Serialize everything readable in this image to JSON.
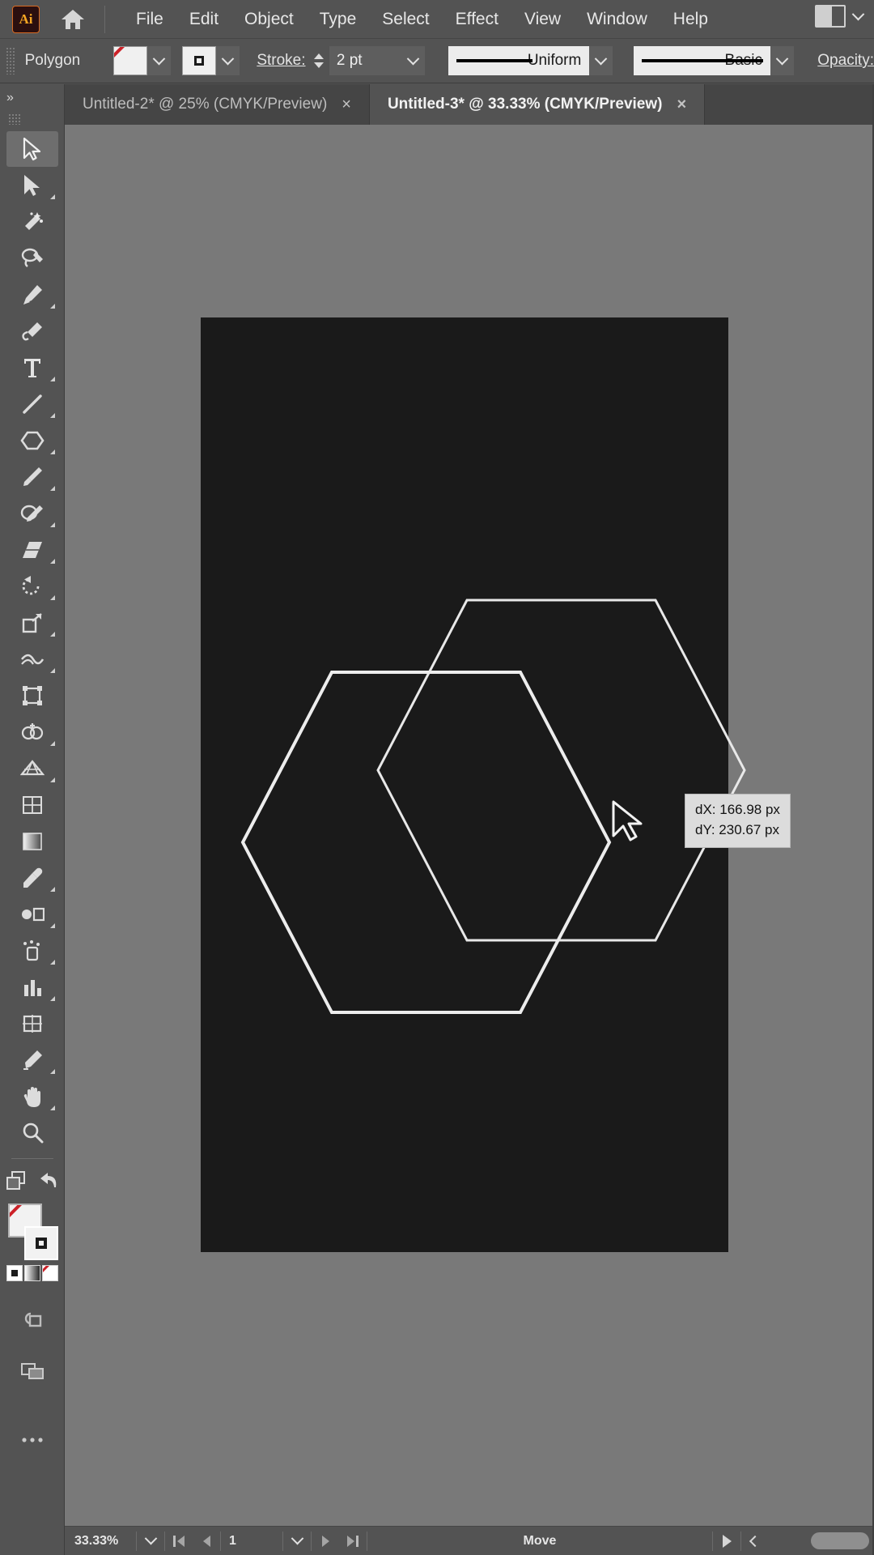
{
  "app": {
    "name": "Adobe Illustrator",
    "logo_text": "Ai",
    "home_icon": "home-icon",
    "workspace_icon": "workspace-switcher-icon",
    "workspace_caret": "chevron-down-icon"
  },
  "menu": {
    "items": [
      {
        "label": "File"
      },
      {
        "label": "Edit"
      },
      {
        "label": "Object"
      },
      {
        "label": "Type"
      },
      {
        "label": "Select"
      },
      {
        "label": "Effect"
      },
      {
        "label": "View"
      },
      {
        "label": "Window"
      },
      {
        "label": "Help"
      }
    ]
  },
  "options_bar": {
    "object_type": "Polygon",
    "fill_swatch": "none",
    "fill_caret": "chevron-down-icon",
    "stroke_swatch": "stroke-square-icon",
    "stroke_caret": "chevron-down-icon",
    "stroke_label": "Stroke:",
    "stroke_weight": "2 pt",
    "stroke_weight_caret": "chevron-down-icon",
    "stroke_stepper": "stepper-icon",
    "profile_value": "Uniform",
    "profile_caret": "chevron-down-icon",
    "brush_value": "Basic",
    "brush_caret": "chevron-down-icon",
    "opacity_label": "Opacity:"
  },
  "tabs": [
    {
      "title": "Untitled-2* @ 25% (CMYK/Preview)",
      "close": "×",
      "active": false
    },
    {
      "title": "Untitled-3* @ 33.33% (CMYK/Preview)",
      "close": "×",
      "active": true
    }
  ],
  "toolbar": {
    "collapse_icon": "double-chevron-right-icon",
    "tools": [
      {
        "name": "selection-tool",
        "selected": true,
        "more": false
      },
      {
        "name": "direct-selection-tool",
        "selected": false,
        "more": true
      },
      {
        "name": "magic-wand-tool",
        "selected": false,
        "more": false
      },
      {
        "name": "lasso-tool",
        "selected": false,
        "more": false
      },
      {
        "name": "pen-tool",
        "selected": false,
        "more": true
      },
      {
        "name": "curvature-tool",
        "selected": false,
        "more": false
      },
      {
        "name": "type-tool",
        "selected": false,
        "more": true
      },
      {
        "name": "line-segment-tool",
        "selected": false,
        "more": true
      },
      {
        "name": "polygon-shape-tool",
        "selected": false,
        "more": true
      },
      {
        "name": "paintbrush-tool",
        "selected": false,
        "more": true
      },
      {
        "name": "shaper-tool",
        "selected": false,
        "more": true
      },
      {
        "name": "eraser-tool",
        "selected": false,
        "more": true
      },
      {
        "name": "rotate-tool",
        "selected": false,
        "more": true
      },
      {
        "name": "scale-tool",
        "selected": false,
        "more": true
      },
      {
        "name": "width-tool",
        "selected": false,
        "more": true
      },
      {
        "name": "free-transform-tool",
        "selected": false,
        "more": false
      },
      {
        "name": "shape-builder-tool",
        "selected": false,
        "more": true
      },
      {
        "name": "perspective-grid-tool",
        "selected": false,
        "more": true
      },
      {
        "name": "mesh-tool",
        "selected": false,
        "more": false
      },
      {
        "name": "gradient-tool",
        "selected": false,
        "more": false
      },
      {
        "name": "eyedropper-tool",
        "selected": false,
        "more": true
      },
      {
        "name": "blend-tool",
        "selected": false,
        "more": true
      },
      {
        "name": "symbol-sprayer-tool",
        "selected": false,
        "more": true
      },
      {
        "name": "column-graph-tool",
        "selected": false,
        "more": true
      },
      {
        "name": "artboard-tool",
        "selected": false,
        "more": false
      },
      {
        "name": "slice-tool",
        "selected": false,
        "more": true
      },
      {
        "name": "hand-tool",
        "selected": false,
        "more": true
      },
      {
        "name": "zoom-tool",
        "selected": false,
        "more": false
      }
    ],
    "arrange_icon": "arrange-documents-icon",
    "undo_icon": "undo-arrow-icon",
    "fill_stroke": {
      "fill": "none",
      "stroke": "black",
      "fill_name": "fill-swatch",
      "stroke_name": "stroke-swatch"
    },
    "color_modes": [
      {
        "name": "color-mode-color"
      },
      {
        "name": "color-mode-gradient"
      },
      {
        "name": "color-mode-none"
      }
    ],
    "draw_mode_icon": "draw-normal-icon",
    "screen_mode_icon": "screen-mode-icon",
    "more_tools_icon": "ellipsis-icon"
  },
  "canvas": {
    "artboard_color": "#1a1a1a",
    "canvas_color": "#797979",
    "shape_stroke_color": "#e8e8e8",
    "shapes": [
      {
        "name": "hexagon-original",
        "note": "source hexagon outline"
      },
      {
        "name": "hexagon-moved-preview",
        "note": "drag preview outline"
      }
    ],
    "cursor": "arrow-cursor",
    "measure_tooltip": {
      "dx": "dX: 166.98 px",
      "dy": "dY: 230.67 px"
    }
  },
  "status_bar": {
    "zoom_level": "33.33%",
    "zoom_caret": "chevron-down-icon",
    "first_page_icon": "first-page-icon",
    "prev_page_icon": "previous-page-icon",
    "page_number": "1",
    "page_caret": "chevron-down-icon",
    "next_page_icon": "next-page-icon",
    "last_page_icon": "last-page-icon",
    "status_text": "Move",
    "play_icon": "play-triangle-icon",
    "back_icon": "chevron-left-icon",
    "scroll_thumb": "horizontal-scrollbar-thumb"
  },
  "colors": {
    "chrome": "#535353",
    "panel_dark": "#454545",
    "accent_red": "#cc2128",
    "brand_orange": "#f5a623"
  }
}
